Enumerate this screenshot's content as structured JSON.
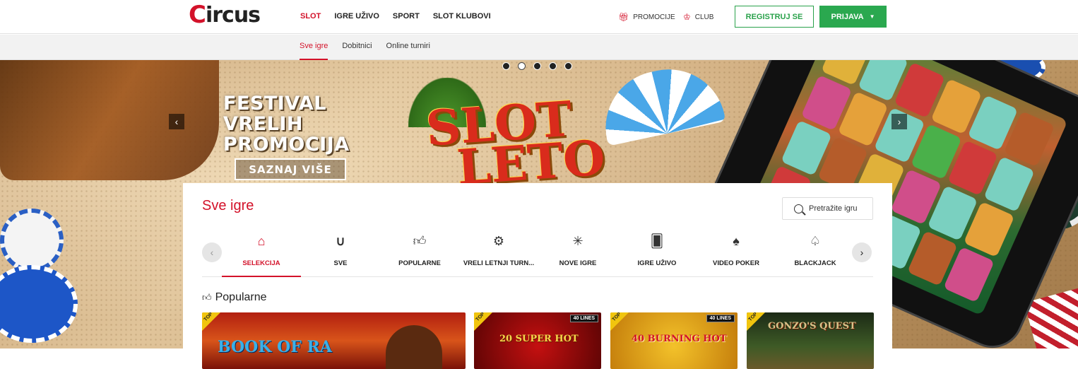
{
  "header": {
    "logo_first": "C",
    "logo_rest": "ircus",
    "nav": [
      {
        "label": "SLOT",
        "active": true
      },
      {
        "label": "IGRE UŽIVO",
        "active": false
      },
      {
        "label": "SPORT",
        "active": false
      },
      {
        "label": "SLOT KLUBOVI",
        "active": false
      }
    ],
    "promocije_label": "PROMOCIJE",
    "club_label": "CLUB",
    "register_label": "REGISTRUJ SE",
    "login_label": "PRIJAVA",
    "accent_color": "#d3122a",
    "green_color": "#2aa84f"
  },
  "subnav": [
    {
      "label": "Sve igre",
      "active": true
    },
    {
      "label": "Dobitnici",
      "active": false
    },
    {
      "label": "Online turniri",
      "active": false
    }
  ],
  "hero": {
    "headline_1": "FESTIVAL",
    "headline_2": "VRELIH",
    "headline_3": "PROMOCIJA",
    "cta_label": "SAZNAJ VIŠE",
    "slot_word_1": "SLOT",
    "slot_word_2": "LETO",
    "slides_count": 5,
    "active_slide": 2
  },
  "panel": {
    "title": "Sve igre",
    "search_placeholder": "Pretražite igru",
    "categories": [
      {
        "label": "SELEKCIJA",
        "icon": "home-icon",
        "active": true
      },
      {
        "label": "SVE",
        "icon": "horseshoe-icon",
        "active": false
      },
      {
        "label": "POPULARNE",
        "icon": "thumbs-up-icon",
        "active": false
      },
      {
        "label": "VRELI LETNJI TURN...",
        "icon": "chip-icon",
        "active": false
      },
      {
        "label": "NOVE IGRE",
        "icon": "sparkle-icon",
        "active": false
      },
      {
        "label": "IGRE UŽIVO",
        "icon": "live-card-icon",
        "active": false
      },
      {
        "label": "VIDEO POKER",
        "icon": "card-icon",
        "active": false
      },
      {
        "label": "BLACKJACK",
        "icon": "blackjack-card-icon",
        "active": false
      }
    ],
    "popular_title": "Popularne",
    "tiles": [
      {
        "name": "BOOK OF RA",
        "badge": "TOP",
        "lines": ""
      },
      {
        "name": "20 SUPER HOT",
        "badge": "TOP",
        "lines": "40 LINES"
      },
      {
        "name": "40 BURNING HOT",
        "badge": "TOP",
        "lines": "40 LINES"
      },
      {
        "name": "GONZO'S QUEST",
        "badge": "TOP",
        "lines": ""
      }
    ]
  }
}
